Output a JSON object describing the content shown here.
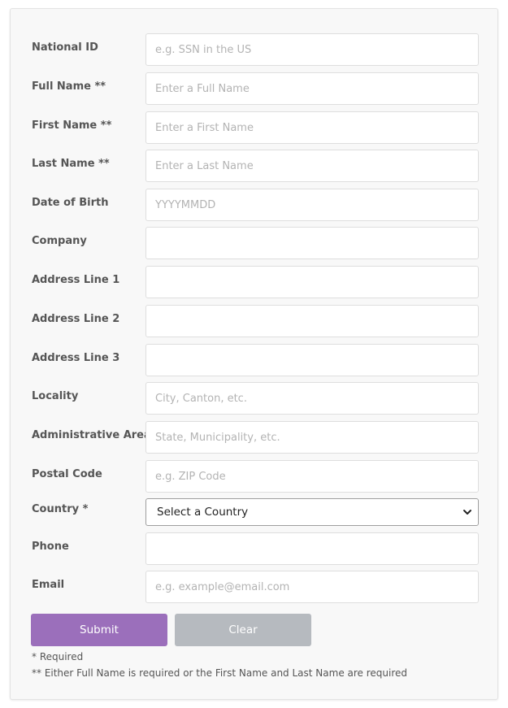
{
  "form": {
    "fields": [
      {
        "label": "National ID",
        "placeholder": "e.g. SSN in the US"
      },
      {
        "label": "Full Name **",
        "placeholder": "Enter a Full Name"
      },
      {
        "label": "First Name **",
        "placeholder": "Enter a First Name"
      },
      {
        "label": "Last Name **",
        "placeholder": "Enter a Last Name"
      },
      {
        "label": "Date of Birth",
        "placeholder": "YYYYMMDD"
      },
      {
        "label": "Company",
        "placeholder": ""
      },
      {
        "label": "Address Line 1",
        "placeholder": ""
      },
      {
        "label": "Address Line 2",
        "placeholder": ""
      },
      {
        "label": "Address Line 3",
        "placeholder": ""
      },
      {
        "label": "Locality",
        "placeholder": "City, Canton, etc."
      },
      {
        "label": "Administrative Area",
        "placeholder": "State, Municipality, etc."
      },
      {
        "label": "Postal Code",
        "placeholder": "e.g. ZIP Code"
      }
    ],
    "country": {
      "label": "Country *",
      "selected": "Select a Country",
      "icon": "chevron-down-icon"
    },
    "phone": {
      "label": "Phone",
      "placeholder": ""
    },
    "email": {
      "label": "Email",
      "placeholder": "e.g. example@email.com"
    },
    "buttons": {
      "submit": "Submit",
      "clear": "Clear"
    },
    "notes": {
      "required": "* Required",
      "either": "** Either Full Name is required or the First Name and Last Name are required"
    }
  },
  "colors": {
    "submit": "#9b6fbb",
    "clear": "#b6babf",
    "card_background": "#f8f8f8"
  }
}
